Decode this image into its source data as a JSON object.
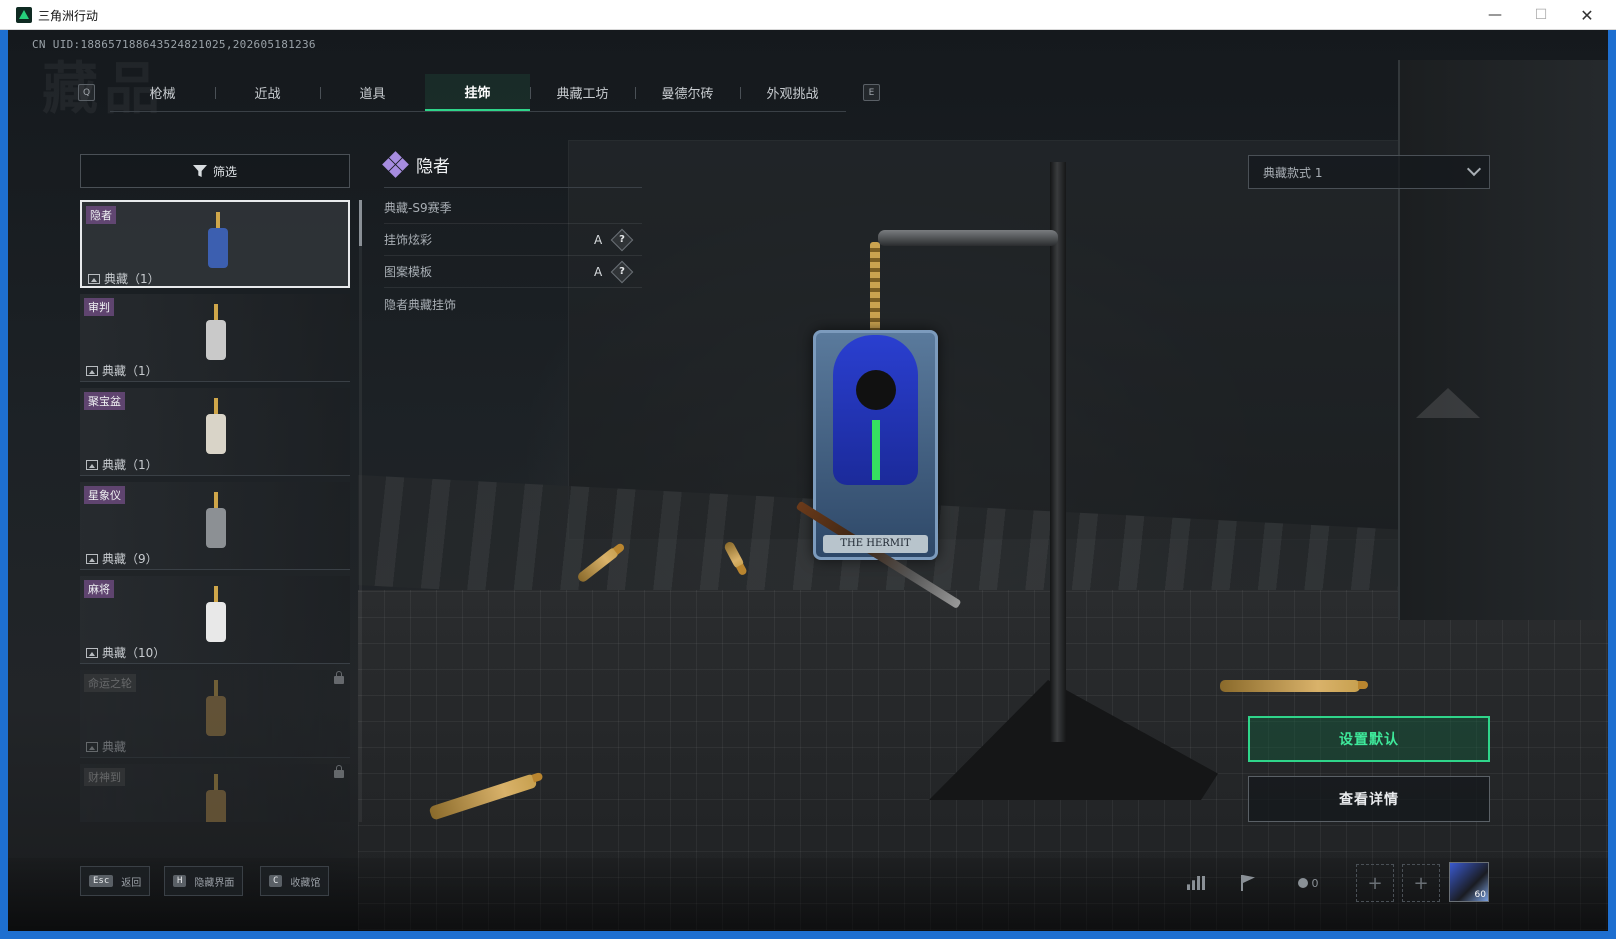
{
  "window": {
    "title": "三角洲行动",
    "minimize_glyph": "—",
    "maximize_glyph": "☐",
    "close_glyph": "✕"
  },
  "header": {
    "uid": "CN UID:18865718864352482102​5,202605181236",
    "watermark": "藏品"
  },
  "tabs": {
    "prev_key": "Q",
    "next_key": "E",
    "items": [
      {
        "label": "枪械",
        "active": false
      },
      {
        "label": "近战",
        "active": false
      },
      {
        "label": "道具",
        "active": false
      },
      {
        "label": "挂饰",
        "active": true
      },
      {
        "label": "典藏工坊",
        "active": false
      },
      {
        "label": "曼德尔砖",
        "active": false
      },
      {
        "label": "外观挑战",
        "active": false
      }
    ]
  },
  "filter": {
    "label": "筛选"
  },
  "list": {
    "items": [
      {
        "name": "隐者",
        "count": "典藏（1）",
        "locked": false,
        "selected": true,
        "color": "#3c5fb0"
      },
      {
        "name": "审判",
        "count": "典藏（1）",
        "locked": false,
        "selected": false,
        "color": "#c9c9c9"
      },
      {
        "name": "聚宝盆",
        "count": "典藏（1）",
        "locked": false,
        "selected": false,
        "color": "#d9d4c8"
      },
      {
        "name": "星象仪",
        "count": "典藏（9）",
        "locked": false,
        "selected": false,
        "color": "#8c9094"
      },
      {
        "name": "麻将",
        "count": "典藏（10）",
        "locked": false,
        "selected": false,
        "color": "#e8e8e8"
      },
      {
        "name": "命运之轮",
        "count": "典藏",
        "locked": true,
        "selected": false,
        "color": "#b08a4a"
      },
      {
        "name": "财神到",
        "count": "",
        "locked": true,
        "selected": false,
        "color": "#b08a4a"
      }
    ]
  },
  "detail": {
    "title": "隐者",
    "season": "典藏-S9赛季",
    "rows": [
      {
        "label": "挂饰炫彩",
        "grade": "A",
        "help": "?"
      },
      {
        "label": "图案模板",
        "grade": "A",
        "help": "?"
      }
    ],
    "description": "隐者典藏挂饰",
    "charm_caption": "THE HERMIT"
  },
  "right": {
    "style_select": "典藏款式 1",
    "set_default": "设置默认",
    "view_details": "查看详情"
  },
  "bottom": {
    "hints": [
      {
        "key": "Esc",
        "label": "返回"
      },
      {
        "key": "H",
        "label": "隐藏界面"
      },
      {
        "key": "C",
        "label": "收藏馆"
      }
    ],
    "friend_count": "0",
    "plus": "+",
    "avatar_level": "60"
  },
  "colors": {
    "accent_green": "#2fd58a",
    "item_tag": "#785090",
    "window_frame": "#1e6fd0"
  }
}
